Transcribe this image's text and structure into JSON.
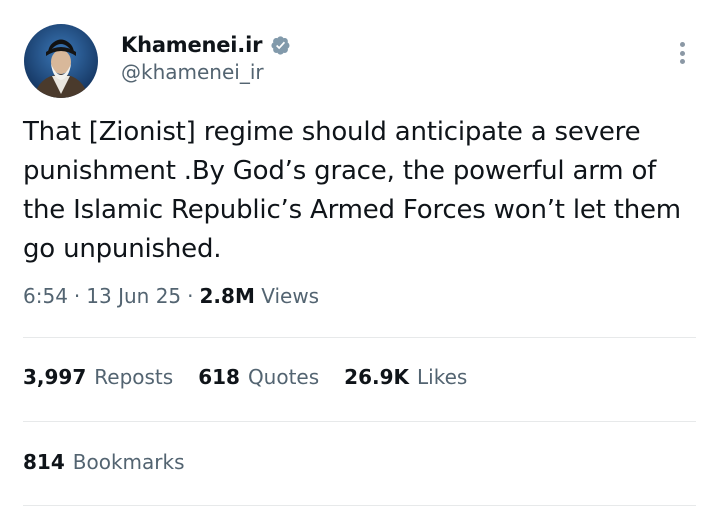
{
  "author": {
    "display_name": "Khamenei.ir",
    "handle": "@khamenei_ir",
    "verified_icon": "verified-badge-icon",
    "verified_color": "#829aab"
  },
  "tweet": {
    "text": "That [Zionist] regime should anticipate a severe punishment .By God’s grace, the powerful arm of the Islamic Republic’s Armed Forces won’t let them go unpunished.",
    "time": "6:54",
    "date": "13 Jun 25",
    "separator": "·",
    "views_count": "2.8M",
    "views_label": "Views"
  },
  "stats": {
    "reposts_count": "3,997",
    "reposts_label": "Reposts",
    "quotes_count": "618",
    "quotes_label": "Quotes",
    "likes_count": "26.9K",
    "likes_label": "Likes",
    "bookmarks_count": "814",
    "bookmarks_label": "Bookmarks"
  },
  "colors": {
    "text_primary": "#0f1419",
    "text_secondary": "#536471",
    "divider": "#e7e9ea"
  }
}
